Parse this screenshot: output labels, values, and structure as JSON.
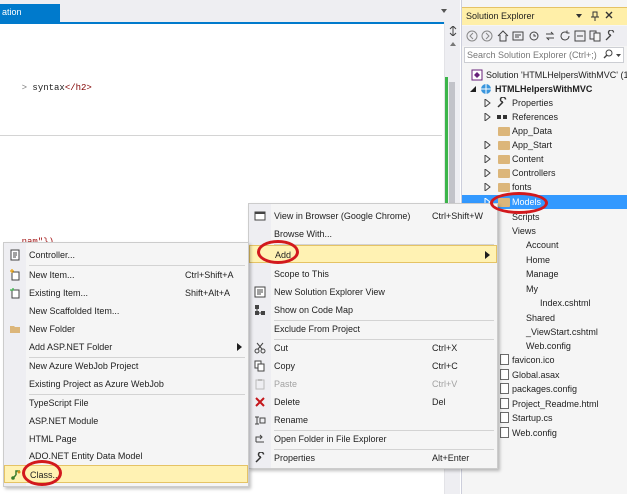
{
  "editor": {
    "tab_label": "ation",
    "code_lines": [
      {
        "text": "syntax",
        "tag": "</h2>",
        "prefix": "> "
      },
      {
        "text": "nam\"})"
      }
    ]
  },
  "solution_explorer": {
    "title": "Solution Explorer",
    "search_placeholder": "Search Solution Explorer (Ctrl+;)",
    "tree": [
      {
        "label": "Solution 'HTMLHelpersWithMVC' (1",
        "icon": "solution-icon",
        "bold": false
      },
      {
        "label": "HTMLHelpersWithMVC",
        "icon": "web-project-icon",
        "bold": true
      },
      {
        "label": "Properties",
        "icon": "wrench-icon"
      },
      {
        "label": "References",
        "icon": "references-icon"
      },
      {
        "label": "App_Data",
        "icon": "folder-icon"
      },
      {
        "label": "App_Start",
        "icon": "folder-icon"
      },
      {
        "label": "Content",
        "icon": "folder-icon"
      },
      {
        "label": "Controllers",
        "icon": "folder-icon"
      },
      {
        "label": "fonts",
        "icon": "folder-icon"
      },
      {
        "label": "Models",
        "icon": "folder-icon"
      },
      {
        "label": "Scripts",
        "icon": "folder-icon"
      },
      {
        "label": "Views",
        "icon": "folder-icon"
      },
      {
        "label": "Account",
        "icon": "folder-icon"
      },
      {
        "label": "Home",
        "icon": "folder-icon"
      },
      {
        "label": "Manage",
        "icon": "folder-icon"
      },
      {
        "label": "My",
        "icon": "folder-icon"
      },
      {
        "label": "Index.cshtml",
        "icon": "cshtml-icon"
      },
      {
        "label": "Shared",
        "icon": "folder-icon"
      },
      {
        "label": "_ViewStart.cshtml",
        "icon": "cshtml-icon"
      },
      {
        "label": "Web.config",
        "icon": "config-icon"
      },
      {
        "label": "favicon.ico",
        "icon": "file-icon"
      },
      {
        "label": "Global.asax",
        "icon": "file-icon"
      },
      {
        "label": "packages.config",
        "icon": "config-icon"
      },
      {
        "label": "Project_Readme.html",
        "icon": "html-file-icon"
      },
      {
        "label": "Startup.cs",
        "icon": "cs-file-icon"
      },
      {
        "label": "Web.config",
        "icon": "config-icon"
      }
    ]
  },
  "context_menu": {
    "items": [
      {
        "label": "View in Browser (Google Chrome)",
        "shortcut": "Ctrl+Shift+W",
        "icon": "browser-icon"
      },
      {
        "label": "Browse With...",
        "shortcut": ""
      },
      {
        "label": "Add",
        "shortcut": "",
        "submenu": true,
        "highlighted": true
      },
      {
        "label": "Scope to This",
        "shortcut": ""
      },
      {
        "label": "New Solution Explorer View",
        "shortcut": "",
        "icon": "new-view-icon"
      },
      {
        "label": "Show on Code Map",
        "shortcut": "",
        "icon": "code-map-icon"
      },
      {
        "label": "Exclude From Project",
        "shortcut": ""
      },
      {
        "label": "Cut",
        "shortcut": "Ctrl+X",
        "icon": "cut-icon"
      },
      {
        "label": "Copy",
        "shortcut": "Ctrl+C",
        "icon": "copy-icon"
      },
      {
        "label": "Paste",
        "shortcut": "Ctrl+V",
        "icon": "paste-icon",
        "disabled": true
      },
      {
        "label": "Delete",
        "shortcut": "Del",
        "icon": "delete-icon"
      },
      {
        "label": "Rename",
        "shortcut": "",
        "icon": "rename-icon"
      },
      {
        "label": "Open Folder in File Explorer",
        "shortcut": "",
        "icon": "open-folder-icon"
      },
      {
        "label": "Properties",
        "shortcut": "Alt+Enter",
        "icon": "wrench-icon"
      }
    ]
  },
  "add_submenu": {
    "items": [
      {
        "label": "Controller...",
        "shortcut": "",
        "icon": "controller-icon"
      },
      {
        "label": "New Item...",
        "shortcut": "Ctrl+Shift+A",
        "icon": "new-item-icon"
      },
      {
        "label": "Existing Item...",
        "shortcut": "Shift+Alt+A",
        "icon": "existing-item-icon"
      },
      {
        "label": "New Scaffolded Item...",
        "shortcut": ""
      },
      {
        "label": "New Folder",
        "shortcut": "",
        "icon": "folder-icon"
      },
      {
        "label": "Add ASP.NET Folder",
        "shortcut": "",
        "submenu": true
      },
      {
        "label": "New Azure WebJob Project",
        "shortcut": ""
      },
      {
        "label": "Existing Project as Azure WebJob",
        "shortcut": ""
      },
      {
        "label": "TypeScript File",
        "shortcut": ""
      },
      {
        "label": "ASP.NET Module",
        "shortcut": ""
      },
      {
        "label": "HTML Page",
        "shortcut": ""
      },
      {
        "label": "ADO.NET Entity Data Model",
        "shortcut": ""
      },
      {
        "label": "Class...",
        "shortcut": "",
        "icon": "class-icon",
        "highlighted": true
      }
    ]
  },
  "colors": {
    "accent": "#007acc",
    "selection": "#3399ff",
    "highlight_bg": "#fff2b3",
    "annotation_ring": "#d2191d"
  }
}
